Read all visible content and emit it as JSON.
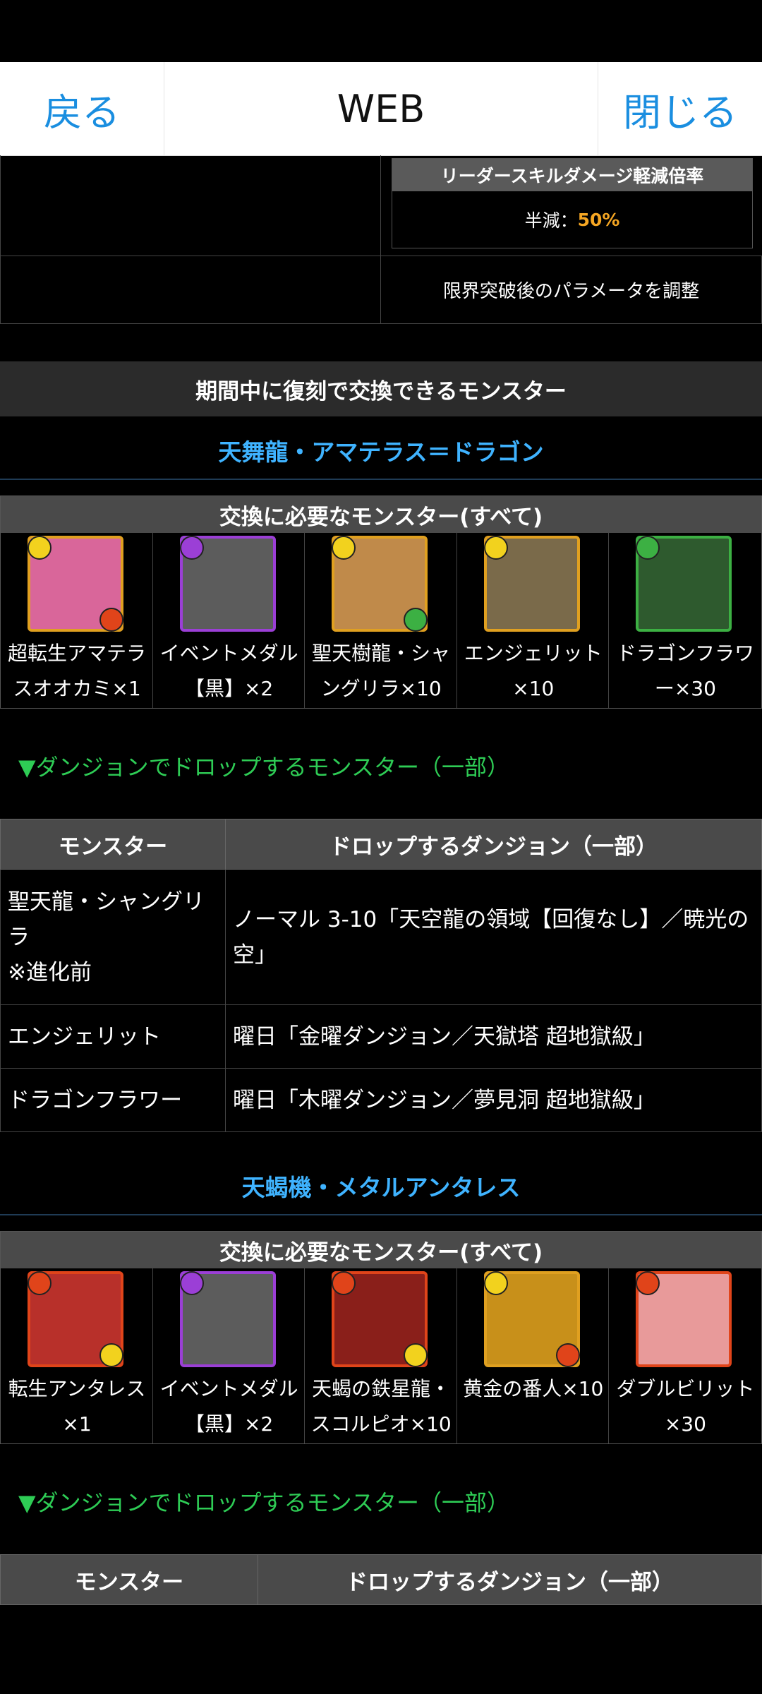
{
  "nav": {
    "back_label": "戻る",
    "title": "WEB",
    "close_label": "閉じる"
  },
  "top": {
    "leader_skill_header": "リーダースキルダメージ軽減倍率",
    "reduction_label": "半減：",
    "reduction_value": "50%",
    "limit_break_note": "限界突破後のパラメータを調整"
  },
  "section_title": "期間中に復刻で交換できるモンスター",
  "groups": [
    {
      "title": "天舞龍・アマテラス＝ドラゴン",
      "exchange_header": "交換に必要なモンスター(すべて)",
      "monsters": [
        {
          "line1": "超転生アマテラ",
          "line2": "スオオカミ×1",
          "bg": "#d9669a",
          "border": "#e0a020",
          "attr_tl": "#f2d21e",
          "attr_br": "#e0441a",
          "icon": "amaterasu-icon"
        },
        {
          "line1": "イベントメダル",
          "line2": "【黒】×2",
          "bg": "#5c5c5c",
          "border": "#9b3fd6",
          "attr_tl": "#9b3fd6",
          "attr_br": "",
          "icon": "event-medal-black-icon"
        },
        {
          "line1": "聖天樹龍・シャ",
          "line2": "ングリラ×10",
          "bg": "#c08a4a",
          "border": "#e0a020",
          "attr_tl": "#f2d21e",
          "attr_br": "#3cb043",
          "icon": "shangri-la-icon"
        },
        {
          "line1": "エンジェリット",
          "line2": "×10",
          "bg": "#7a6a4a",
          "border": "#e0a020",
          "attr_tl": "#f2d21e",
          "attr_br": "",
          "icon": "angelit-icon"
        },
        {
          "line1": "ドラゴンフラワ",
          "line2": "ー×30",
          "bg": "#2e5a2e",
          "border": "#3cb043",
          "attr_tl": "#3cb043",
          "attr_br": "",
          "icon": "dragon-flower-icon"
        }
      ],
      "drop_label": "▼ダンジョンでドロップするモンスター（一部）",
      "drop_headers": [
        "モンスター",
        "ドロップするダンジョン（一部）"
      ],
      "drop_rows": [
        {
          "monster": "聖天龍・シャングリラ",
          "note": "※進化前",
          "dungeon": "ノーマル 3-10「天空龍の領域【回復なし】／暁光の空」"
        },
        {
          "monster": "エンジェリット",
          "note": "",
          "dungeon": "曜日「金曜ダンジョン／天獄塔 超地獄級」"
        },
        {
          "monster": "ドラゴンフラワー",
          "note": "",
          "dungeon": "曜日「木曜ダンジョン／夢見洞 超地獄級」"
        }
      ]
    },
    {
      "title": "天蝎機・メタルアンタレス",
      "exchange_header": "交換に必要なモンスター(すべて)",
      "monsters": [
        {
          "line1": "転生アンタレス",
          "line2": "×1",
          "bg": "#b8302a",
          "border": "#e0441a",
          "attr_tl": "#e0441a",
          "attr_br": "#f2d21e",
          "icon": "antares-icon"
        },
        {
          "line1": "イベントメダル",
          "line2": "【黒】×2",
          "bg": "#5c5c5c",
          "border": "#9b3fd6",
          "attr_tl": "#9b3fd6",
          "attr_br": "",
          "icon": "event-medal-black-icon"
        },
        {
          "line1": "天蝎の鉄星龍・",
          "line2": "スコルピオ×10",
          "bg": "#8a1f1a",
          "border": "#e0441a",
          "attr_tl": "#e0441a",
          "attr_br": "#f2d21e",
          "icon": "scorpio-icon"
        },
        {
          "line1": "黄金の番人×10",
          "line2": "",
          "bg": "#c8901a",
          "border": "#e0a020",
          "attr_tl": "#f2d21e",
          "attr_br": "#e0441a",
          "icon": "golden-guardian-icon"
        },
        {
          "line1": "ダブルビリット",
          "line2": "×30",
          "bg": "#e89a9a",
          "border": "#e0441a",
          "attr_tl": "#e0441a",
          "attr_br": "",
          "icon": "double-bilit-icon"
        }
      ],
      "drop_label": "▼ダンジョンでドロップするモンスター（一部）",
      "drop_headers": [
        "モンスター",
        "ドロップするダンジョン（一部）"
      ]
    }
  ]
}
